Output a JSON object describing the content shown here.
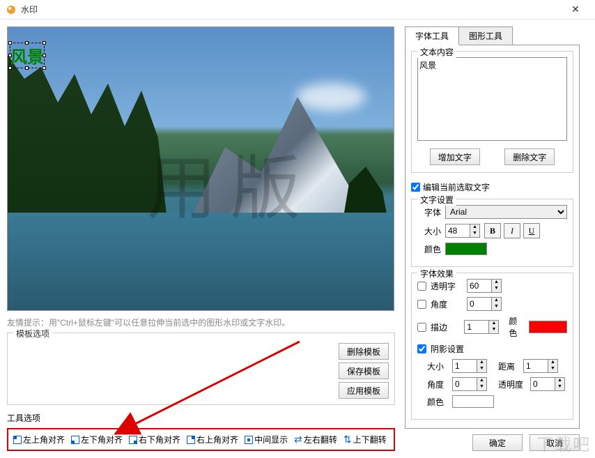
{
  "window": {
    "title": "水印",
    "close": "✕"
  },
  "preview": {
    "watermark_text": "风景",
    "trial_text": "用版"
  },
  "hint": "友情提示：用\"Ctrl+鼠标左键\"可以任意拉伸当前选中的图形水印或文字水印。",
  "template": {
    "legend": "模板选项",
    "delete": "删除模板",
    "save": "保存模板",
    "apply": "应用模板"
  },
  "tools": {
    "legend": "工具选项",
    "items": [
      "左上角对齐",
      "左下角对齐",
      "右下角对齐",
      "右上角对齐",
      "中间显示",
      "左右翻转",
      "上下翻转"
    ]
  },
  "tabs": {
    "font": "字体工具",
    "shape": "图形工具"
  },
  "text_content": {
    "label": "文本内容",
    "value": "风景",
    "add": "增加文字",
    "delete": "删除文字"
  },
  "edit_selected": "编辑当前选取文字",
  "text_settings": {
    "label": "文字设置",
    "font_label": "字体",
    "font_value": "Arial",
    "size_label": "大小",
    "size_value": "48",
    "bold": "B",
    "italic": "I",
    "underline": "U",
    "color_label": "颜色"
  },
  "font_effects": {
    "label": "字体效果",
    "transparent": "透明字",
    "transparent_value": "60",
    "angle": "角度",
    "angle_value": "0",
    "stroke": "描边",
    "stroke_value": "1",
    "stroke_color": "颜色",
    "shadow": "阴影设置",
    "shadow_size": "大小",
    "shadow_size_value": "1",
    "shadow_distance": "距离",
    "shadow_distance_value": "1",
    "shadow_angle": "角度",
    "shadow_angle_value": "0",
    "shadow_opacity": "透明度",
    "shadow_opacity_value": "0",
    "shadow_color": "颜色"
  },
  "buttons": {
    "ok": "确定",
    "cancel": "取消"
  },
  "colors": {
    "text": "#008000",
    "stroke": "#ff0000",
    "shadow": "#ffffff"
  },
  "download_watermark": "下载吧"
}
